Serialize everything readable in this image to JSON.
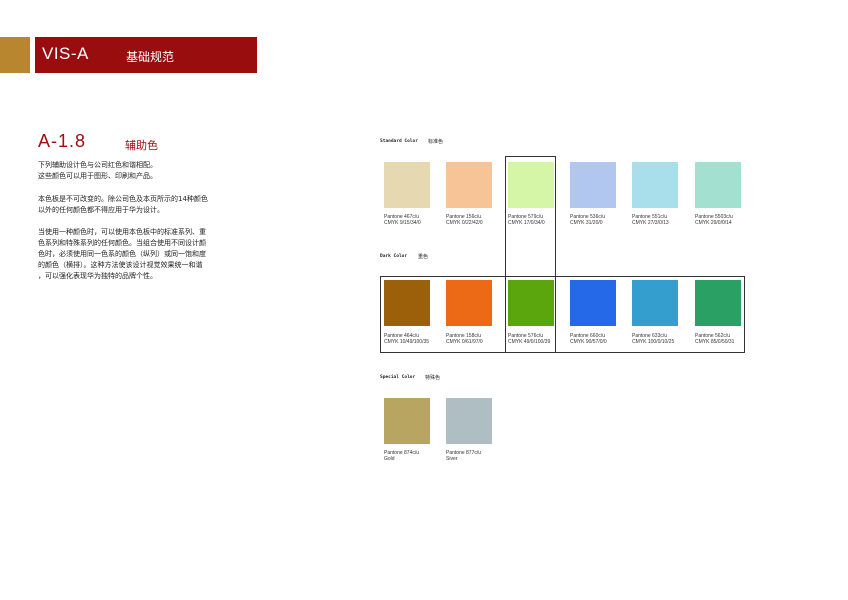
{
  "header": {
    "code": "VIS-A",
    "title": "基础规范",
    "colors": {
      "gold": "#b8862f",
      "red": "#9a0d0f"
    }
  },
  "section": {
    "code": "A-1.8",
    "title": "辅助色",
    "paragraphs": [
      [
        "下列辅助设计色与公司红色和谐相配。",
        "这些颜色可以用于图形、印刷和产品。"
      ],
      [
        "本色板是不可改变的。除公司色及本页所示的14种颜色",
        "以外的任何颜色都不得应用于华为设计。"
      ],
      [
        "当使用一种颜色时，可以使用本色板中的标准系列、重",
        "色系列和特殊系列的任何颜色。当组合使用不同设计颜",
        "色时，必须使用同一色系的颜色（纵列）或同一饱和度",
        "的颜色（横排）。这种方法使该设计视觉效果统一和谐",
        "，可以强化表现华为独特的品牌个性。"
      ]
    ]
  },
  "groups": {
    "standard": {
      "label": "Standard Color",
      "label_cn": "标准色",
      "swatches": [
        {
          "color": "#e6d8b0",
          "line1": "Pantone 467c/u",
          "line2": "CMYK 9/15/34/0"
        },
        {
          "color": "#f7c497",
          "line1": "Pantone 156c/u",
          "line2": "CMYK 0/22/42/0"
        },
        {
          "color": "#d4f6a6",
          "line1": "Pantone 579c/u",
          "line2": "CMYK 17/0/34/0"
        },
        {
          "color": "#b1c7ef",
          "line1": "Pantone 536c/u",
          "line2": "CMYK 31/20/0"
        },
        {
          "color": "#a9dfea",
          "line1": "Pantone 551c/u",
          "line2": "CMYK 27/3/0/13"
        },
        {
          "color": "#a4e0d0",
          "line1": "Pantone 5503c/u",
          "line2": "CMYK 29/0/0/14"
        }
      ]
    },
    "dark": {
      "label": "Dark Color",
      "label_cn": "重色",
      "swatches": [
        {
          "color": "#9c5f0a",
          "line1": "Pantone 464c/u",
          "line2": "CMYK 10/49/100/35"
        },
        {
          "color": "#ec6a16",
          "line1": "Pantone 158c/u",
          "line2": "CMYK 0/61/97/0"
        },
        {
          "color": "#5ba60c",
          "line1": "Pantone 576c/u",
          "line2": "CMYK 49/0/100/39"
        },
        {
          "color": "#2569e8",
          "line1": "Pantone 660c/u",
          "line2": "CMYK 90/57/0/0"
        },
        {
          "color": "#349ece",
          "line1": "Pantone 633c/u",
          "line2": "CMYK 100/0/10/25"
        },
        {
          "color": "#2aa064",
          "line1": "Pantone 562c/u",
          "line2": "CMYK 85/0/50/31"
        }
      ]
    },
    "special": {
      "label": "Special Color",
      "label_cn": "特殊色",
      "swatches": [
        {
          "color": "#b9a562",
          "line1": "Pantone 874c/u",
          "line2": "Gold"
        },
        {
          "color": "#aebec2",
          "line1": "Pantone 877c/u",
          "line2": "Siver"
        }
      ]
    }
  }
}
